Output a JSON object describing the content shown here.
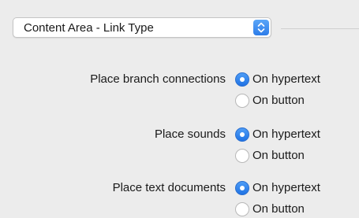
{
  "content_area_select": {
    "selected": "Content Area - Link Type"
  },
  "settings": [
    {
      "label": "Place branch connections",
      "options": [
        "On hypertext",
        "On button"
      ],
      "selected": "On hypertext"
    },
    {
      "label": "Place sounds",
      "options": [
        "On hypertext",
        "On button"
      ],
      "selected": "On hypertext"
    },
    {
      "label": "Place text documents",
      "options": [
        "On hypertext",
        "On button"
      ],
      "selected": "On hypertext"
    }
  ],
  "colors": {
    "accent": "#2d7ce9",
    "background": "#ececec"
  }
}
